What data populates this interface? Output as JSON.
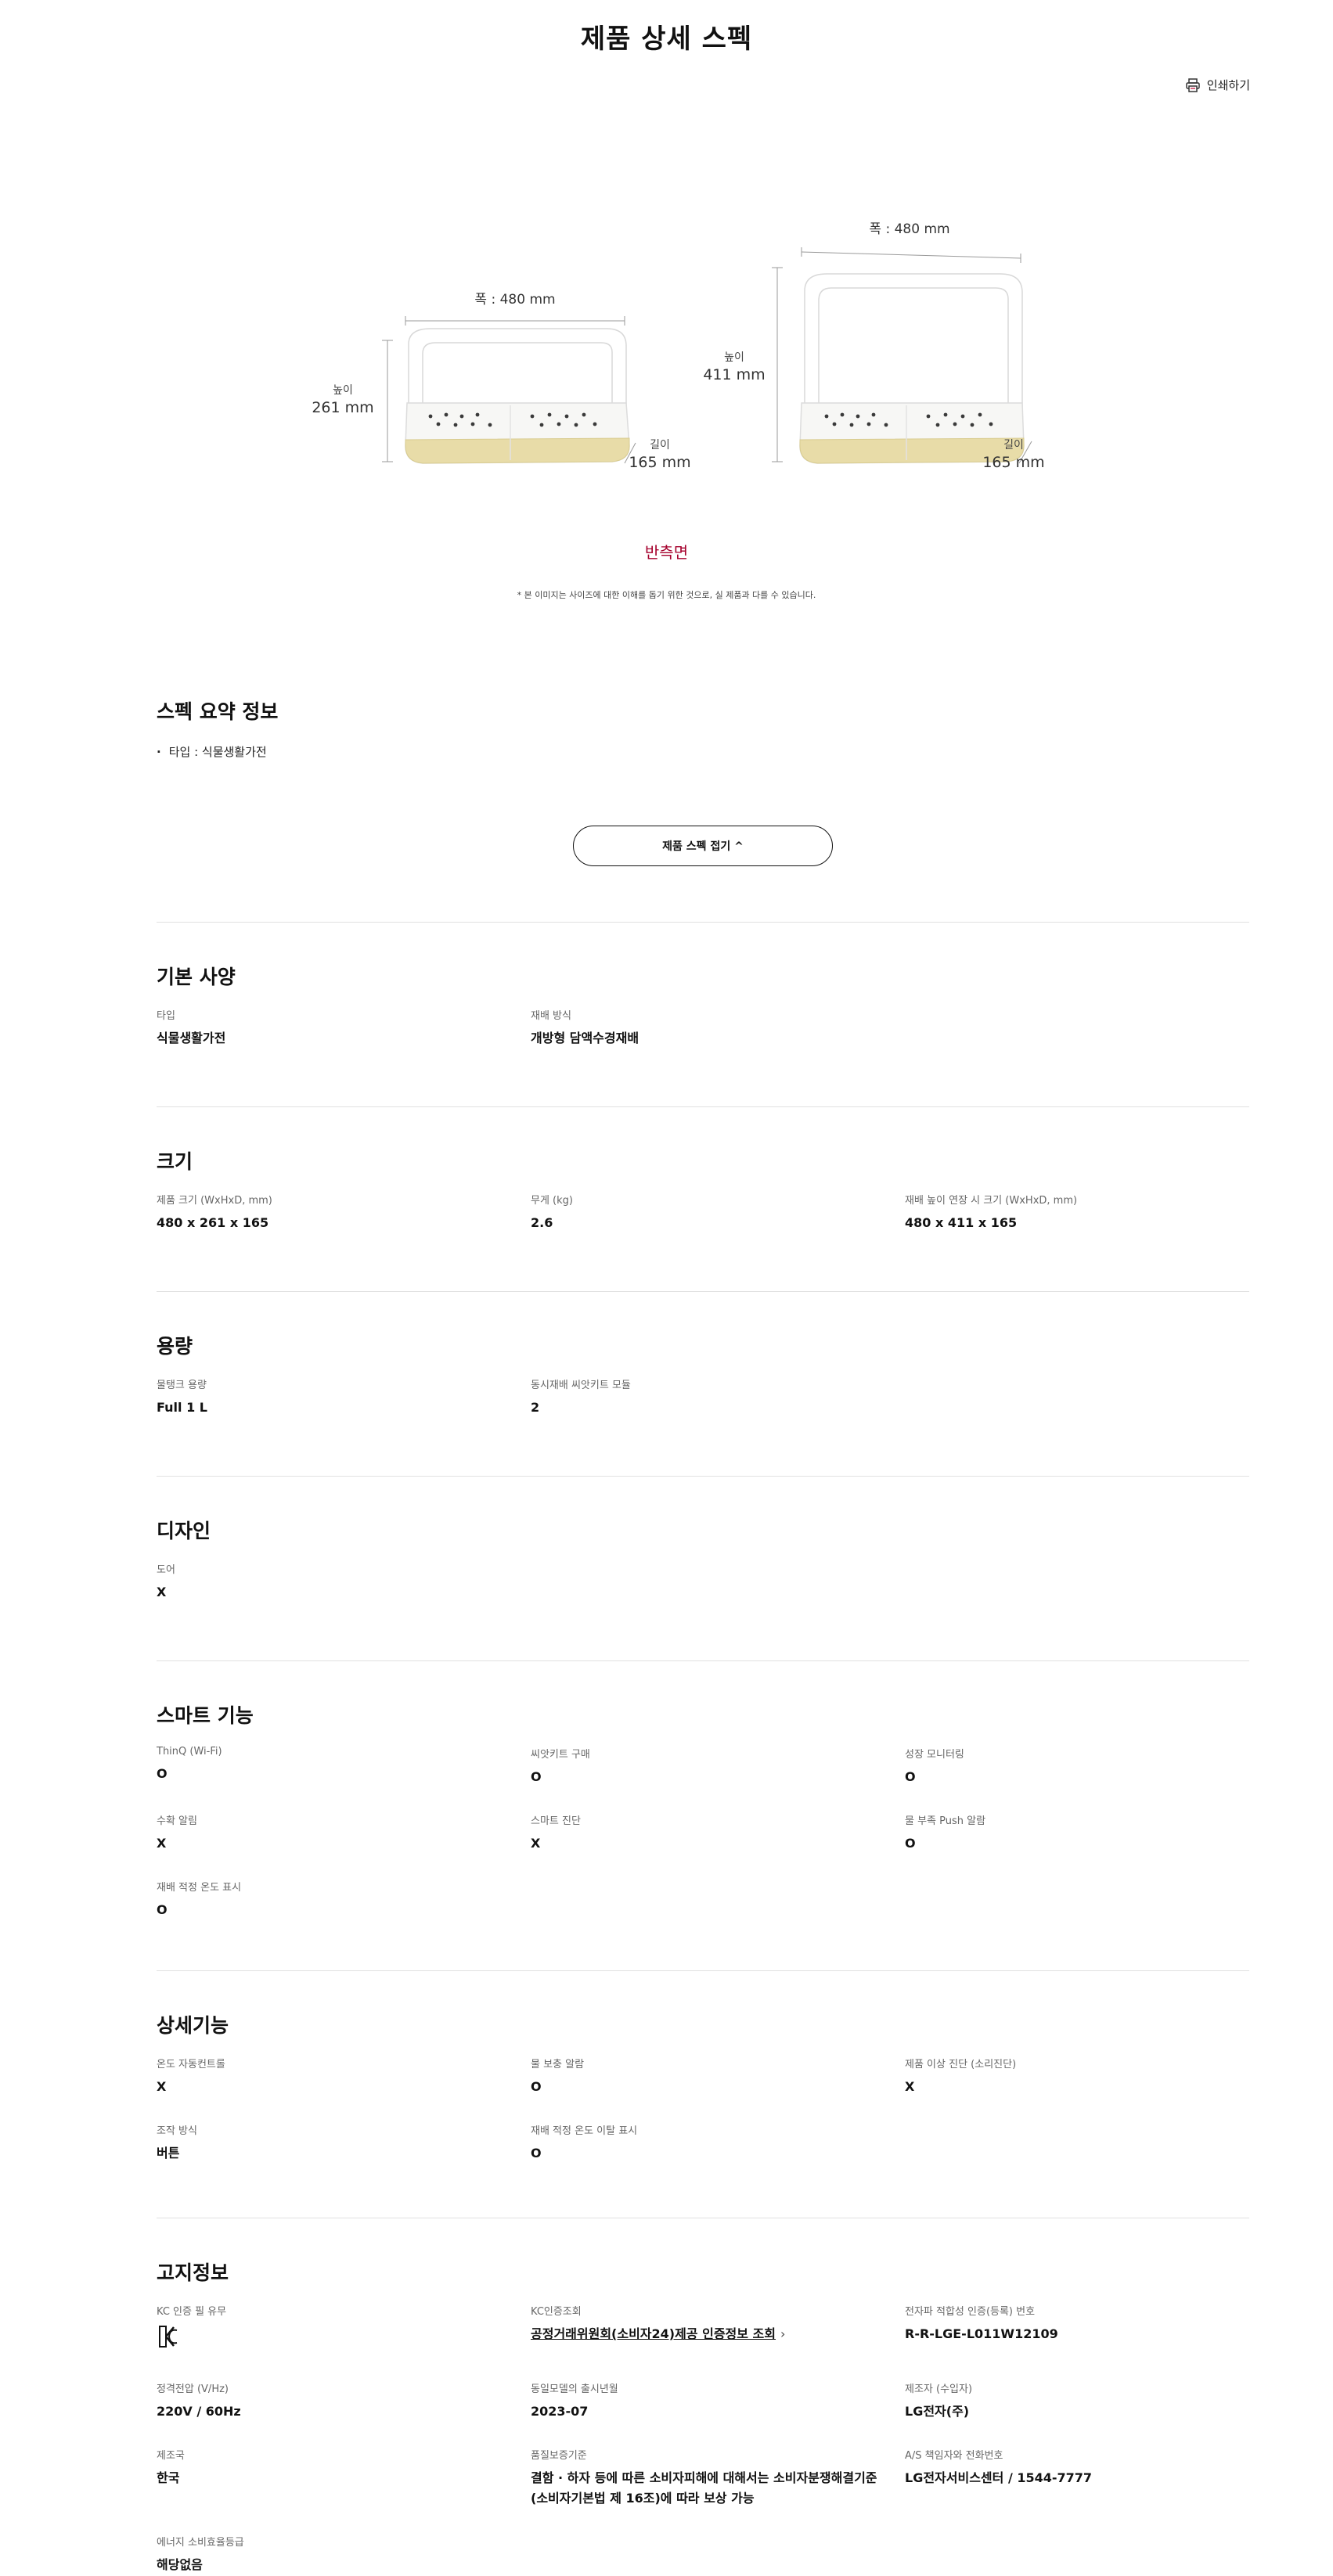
{
  "page": {
    "title": "제품 상세 스펙",
    "print_label": "인쇄하기"
  },
  "illustration": {
    "product_a": {
      "width_label": "폭 : 480 mm",
      "height_label": "높이",
      "height_value": "261 mm",
      "depth_label": "길이",
      "depth_value": "165 mm"
    },
    "product_b": {
      "width_label": "폭 : 480 mm",
      "height_label": "높이",
      "height_value": "411 mm",
      "depth_label": "길이",
      "depth_value": "165 mm"
    },
    "side_label": "반측면",
    "note": "* 본 이미지는 사이즈에 대한 이해를 돕기 위한 것으로, 실 제품과 다를 수 있습니다."
  },
  "summary": {
    "title": "스펙 요약 정보",
    "items": [
      "타입 : 식물생활가전"
    ]
  },
  "fold_button": {
    "label": "제품 스펙 접기 ^"
  },
  "sections": {
    "basic": {
      "title": "기본 사양",
      "items": [
        {
          "label": "타입",
          "value": "식물생활가전"
        },
        {
          "label": "재배 방식",
          "value": "개방형 담액수경재배"
        }
      ]
    },
    "size": {
      "title": "크기",
      "items": [
        {
          "label": "제품 크기 (WxHxD, mm)",
          "value": "480 x 261 x 165"
        },
        {
          "label": "무게 (kg)",
          "value": "2.6"
        },
        {
          "label": "재배 높이 연장 시 크기 (WxHxD, mm)",
          "value": "480 x 411 x 165"
        }
      ]
    },
    "capacity": {
      "title": "용량",
      "items": [
        {
          "label": "물탱크 용량",
          "value": "Full 1 L"
        },
        {
          "label": "동시재배 씨앗키트 모듈",
          "value": "2"
        }
      ]
    },
    "design": {
      "title": "디자인",
      "items": [
        {
          "label": "도어",
          "value": "X"
        }
      ]
    },
    "smart": {
      "title": "스마트 기능",
      "items": [
        {
          "label": "ThinQ (Wi-Fi)",
          "value": "O"
        },
        {
          "label": "씨앗키트 구매",
          "value": "O"
        },
        {
          "label": "성장 모니터링",
          "value": "O"
        },
        {
          "label": "수확 알림",
          "value": "X"
        },
        {
          "label": "스마트 진단",
          "value": "X"
        },
        {
          "label": "물 부족 Push 알람",
          "value": "O"
        },
        {
          "label": "재배 적정 온도 표시",
          "value": "O"
        }
      ]
    },
    "detail": {
      "title": "상세기능",
      "items": [
        {
          "label": "온도 자동컨트롤",
          "value": "X"
        },
        {
          "label": "물 보충 알람",
          "value": "O"
        },
        {
          "label": "제품 이상 진단 (소리진단)",
          "value": "X"
        },
        {
          "label": "조작 방식",
          "value": "버튼"
        },
        {
          "label": "재배 적정 온도 이탈 표시",
          "value": "O"
        }
      ]
    },
    "notice": {
      "title": "고지정보",
      "items": [
        {
          "label": "KC 인증 필 유무",
          "value": ""
        },
        {
          "label": "KC인증조회",
          "value": "공정거래위원회(소비자24)제공 인증정보 조회"
        },
        {
          "label": "전자파 적합성 인증(등록) 번호",
          "value": "R-R-LGE-L011W12109"
        },
        {
          "label": "정격전압 (V/Hz)",
          "value": "220V / 60Hz"
        },
        {
          "label": "동일모델의 출시년월",
          "value": "2023-07"
        },
        {
          "label": "제조자 (수입자)",
          "value": "LG전자(주)"
        },
        {
          "label": "제조국",
          "value": "한국"
        },
        {
          "label": "품질보증기준",
          "value": "결함 · 하자 등에 따른 소비자피해에 대해서는 소비자분쟁해결기준 (소비자기본법 제 16조)에 따라 보상 가능"
        },
        {
          "label": "A/S 책임자와 전화번호",
          "value": "LG전자서비스센터 / 1544-7777"
        },
        {
          "label": "에너지 소비효율등급",
          "value": "해당없음"
        }
      ]
    }
  },
  "colors": {
    "accent": "#a5002c",
    "divider": "#e1e1e1",
    "base_yellow": "#e8dca8"
  }
}
